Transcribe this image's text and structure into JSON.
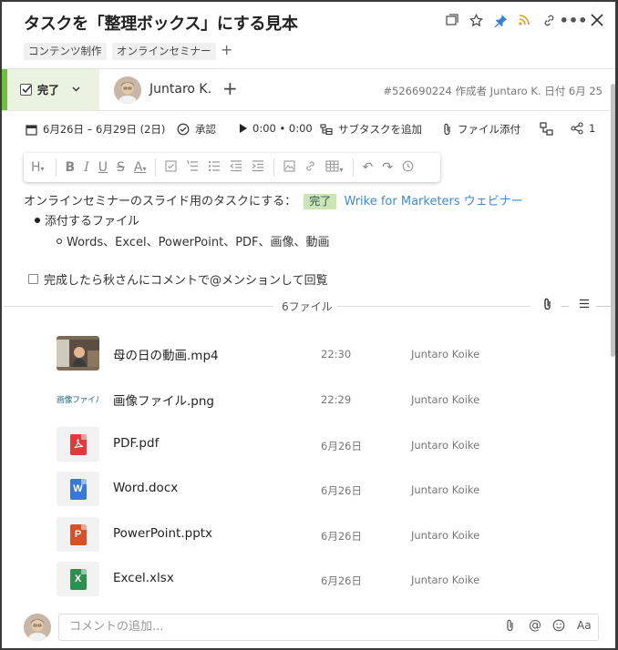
{
  "title": "タスクを「整理ボックス」にする見本",
  "header_icons": [
    "window-icon",
    "star-icon",
    "pin-icon",
    "rss-icon",
    "link-icon",
    "more-icon",
    "close-icon"
  ],
  "tags": [
    "コンテンツ制作",
    "オンラインセミナー"
  ],
  "tag_add": "+",
  "status": {
    "label": "完了",
    "color": "#6fbf3f"
  },
  "assignee": {
    "name": "Juntaro K.",
    "add": "+"
  },
  "meta": "#526690224 作成者 Juntaro K. 日付 6月 25",
  "toolbar": {
    "dates": "6月26日 – 6月29日 (2日)",
    "approval": "承認",
    "timer": "0:00 • 0:00",
    "add_subtask": "サブタスクを追加",
    "attach": "ファイル添付",
    "share_count": "1"
  },
  "description": {
    "line1_prefix": "オンラインセミナーのスライド用のタスクにする：",
    "done_tag": "完了",
    "link": "Wrike for Marketers ウェビナー",
    "bullet1": "添付するファイル",
    "bullet2": "Words、Excel、PowerPoint、PDF、画像、動画",
    "checkbox": "完成したら秋さんにコメントで@メンションして回覧"
  },
  "files_label": "6ファイル",
  "files": [
    {
      "name": "母の日の動画.mp4",
      "time": "22:30",
      "owner": "Juntaro Koike",
      "type": "video"
    },
    {
      "name": "画像ファイル.png",
      "time": "22:29",
      "owner": "Juntaro Koike",
      "type": "image",
      "thumb_text": "画像ファイル"
    },
    {
      "name": "PDF.pdf",
      "time": "6月26日",
      "owner": "Juntaro Koike",
      "type": "pdf"
    },
    {
      "name": "Word.docx",
      "time": "6月26日",
      "owner": "Juntaro Koike",
      "type": "word",
      "letter": "W"
    },
    {
      "name": "PowerPoint.pptx",
      "time": "6月26日",
      "owner": "Juntaro Koike",
      "type": "ppt",
      "letter": "P"
    },
    {
      "name": "Excel.xlsx",
      "time": "6月26日",
      "owner": "Juntaro Koike",
      "type": "excel",
      "letter": "X"
    }
  ],
  "comment": {
    "placeholder": "コメントの追加...",
    "font_btn": "Aa"
  },
  "colors": {
    "word": "#3a78d8",
    "ppt": "#d6502a",
    "excel": "#2f8f4e",
    "pdf": "#e0393e",
    "link": "#3d8ad6"
  }
}
